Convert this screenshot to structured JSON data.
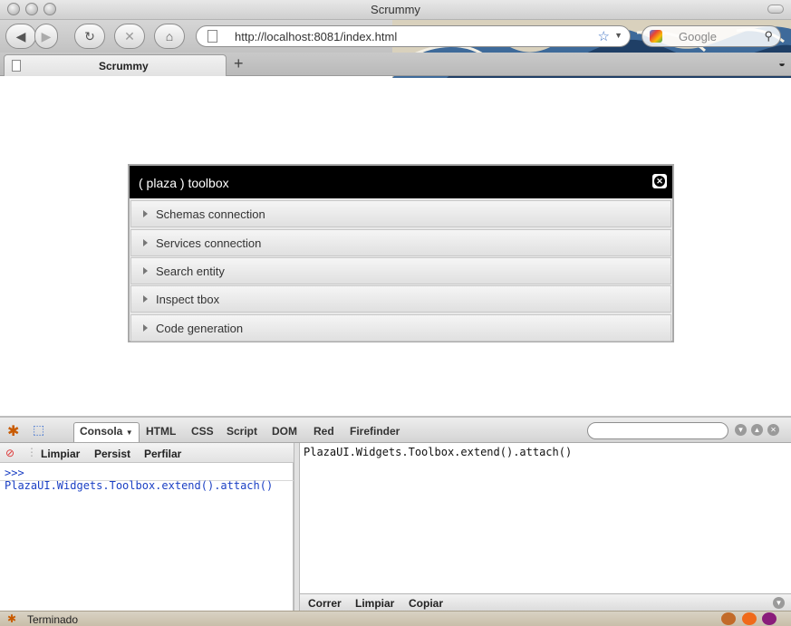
{
  "window": {
    "title": "Scrummy"
  },
  "navigation": {
    "back_icon": "back-arrow-icon",
    "forward_icon": "forward-arrow-icon",
    "url": "http://localhost:8081/index.html",
    "search_placeholder": "Google"
  },
  "tabs": [
    {
      "label": "Scrummy"
    }
  ],
  "toolbox": {
    "title": "( plaza ) toolbox",
    "sections": [
      {
        "label": "Schemas connection"
      },
      {
        "label": "Services connection"
      },
      {
        "label": "Search entity"
      },
      {
        "label": "Inspect tbox"
      },
      {
        "label": "Code generation"
      }
    ]
  },
  "firebug": {
    "tabs": [
      {
        "label": "Consola",
        "active": true
      },
      {
        "label": "HTML"
      },
      {
        "label": "CSS"
      },
      {
        "label": "Script"
      },
      {
        "label": "DOM"
      },
      {
        "label": "Red"
      },
      {
        "label": "Firefinder"
      }
    ],
    "console_toolbar": {
      "clear": "Limpiar",
      "persist": "Persist",
      "profile": "Perfilar"
    },
    "command_history": ">>> PlazaUI.Widgets.Toolbox.extend().attach()",
    "command_editor": "PlazaUI.Widgets.Toolbox.extend().attach()",
    "editor_actions": {
      "run": "Correr",
      "clear": "Limpiar",
      "copy": "Copiar"
    }
  },
  "status": {
    "text": "Terminado"
  }
}
